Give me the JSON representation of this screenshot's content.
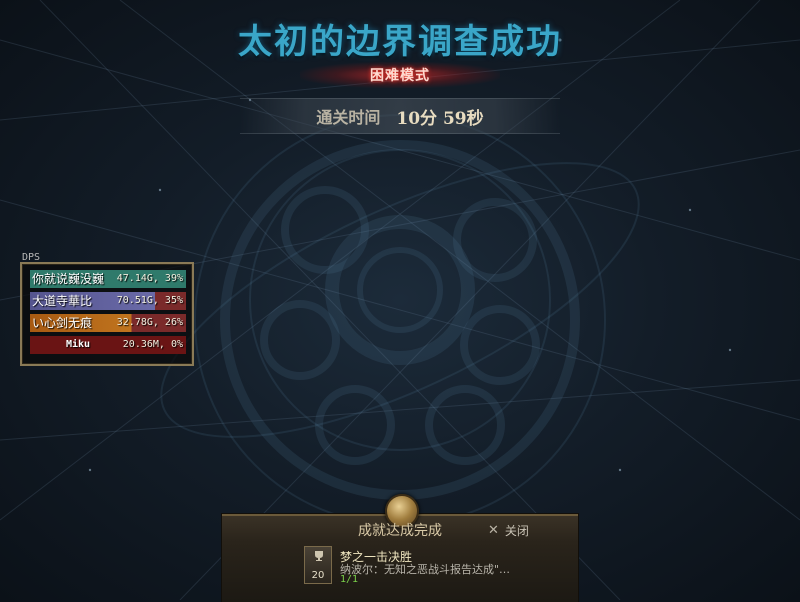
{
  "header": {
    "title": "太初的边界调查成功",
    "mode": "困难模式",
    "clear_label": "通关时间",
    "clear_time": "10分 59秒"
  },
  "dps": {
    "title": "DPS",
    "rows": [
      {
        "name": "你就说巍没巍",
        "value": "47.14G, 39%",
        "color": "#2f7a6b"
      },
      {
        "name": "大道寺華比",
        "value": "70.51G, 35%",
        "color": "#5a5a9a"
      },
      {
        "name": "い心剑无痕",
        "value": "32.78G, 26%",
        "color": "#b0661a"
      },
      {
        "name": "Miku",
        "value": "20.36M, 0%",
        "color": "#7a1a1a"
      }
    ]
  },
  "achievement": {
    "header": "成就达成完成",
    "close_label": "关闭",
    "item": {
      "points": "20",
      "name": "梦之一击决胜",
      "description": "纳波尔：无知之恶战斗报告达成\"…",
      "progress": "1/1"
    }
  }
}
